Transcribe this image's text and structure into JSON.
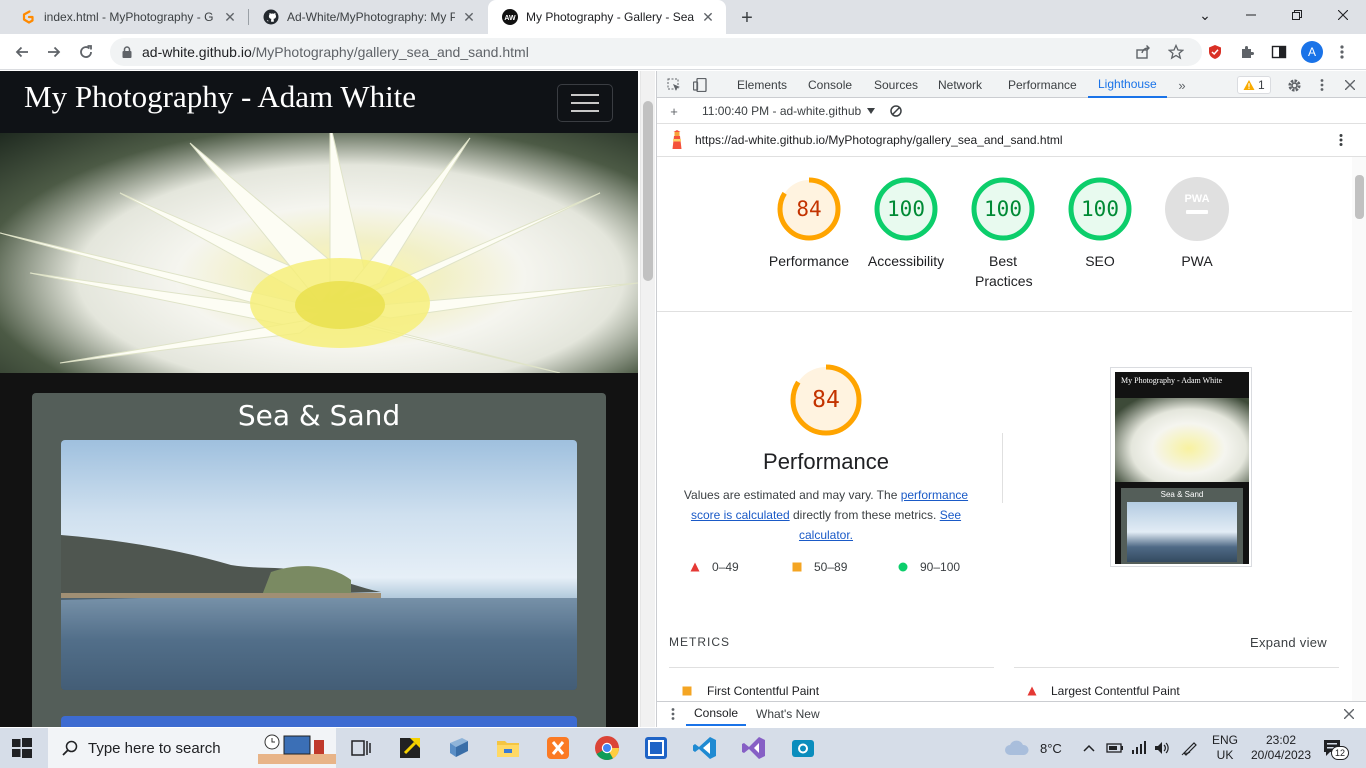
{
  "browser": {
    "tabs": [
      {
        "title": "index.html - MyPhotography - G",
        "favicon": "gitpod-icon"
      },
      {
        "title": "Ad-White/MyPhotography: My P",
        "favicon": "github-icon"
      },
      {
        "title": "My Photography - Gallery - Sea &",
        "favicon": "aw-icon",
        "active": true
      }
    ],
    "favicon_letters": "AW",
    "url_host": "ad-white.github.io",
    "url_path": "/MyPhotography/gallery_sea_and_sand.html",
    "avatar_letter": "A"
  },
  "page": {
    "brand": "My Photography - Adam White",
    "card_title": "Sea & Sand"
  },
  "devtools": {
    "tabs": [
      "Elements",
      "Console",
      "Sources",
      "Network",
      "Performance",
      "Lighthouse"
    ],
    "active_tab": "Lighthouse",
    "warning_count": "1",
    "report_time": "11:00:40 PM - ad-white.github",
    "report_url": "https://ad-white.github.io/MyPhotography/gallery_sea_and_sand.html",
    "scores": [
      {
        "label": "Performance",
        "value": "84",
        "fraction": 0.84,
        "status": "average"
      },
      {
        "label": "Accessibility",
        "value": "100",
        "fraction": 1.0,
        "status": "pass"
      },
      {
        "label": "Best Practices",
        "value": "100",
        "fraction": 1.0,
        "status": "pass"
      },
      {
        "label": "SEO",
        "value": "100",
        "fraction": 1.0,
        "status": "pass"
      },
      {
        "label": "PWA",
        "value": "PWA",
        "fraction": 0,
        "status": "na"
      }
    ],
    "perf": {
      "score": "84",
      "title": "Performance",
      "desc_1": "Values are estimated and may vary. The ",
      "desc_link_1": "performance score is calculated",
      "desc_2": " directly from these metrics. ",
      "desc_link_2": "See calculator."
    },
    "legend": [
      {
        "range": "0–49",
        "shape": "triangle",
        "color": "#e53935"
      },
      {
        "range": "50–89",
        "shape": "square",
        "color": "#f4a523"
      },
      {
        "range": "90–100",
        "shape": "circle",
        "color": "#0cce6b"
      }
    ],
    "thumbnail": {
      "brand": "My Photography - Adam White",
      "card_title": "Sea & Sand"
    },
    "metrics_header": "METRICS",
    "expand_label": "Expand view",
    "metrics": [
      {
        "name": "First Contentful Paint",
        "status": "average"
      },
      {
        "name": "Largest Contentful Paint",
        "status": "fail"
      }
    ],
    "drawer_tabs": [
      "Console",
      "What's New"
    ]
  },
  "taskbar": {
    "search_placeholder": "Type here to search",
    "weather": "8°C",
    "lang_1": "ENG",
    "lang_2": "UK",
    "time": "23:02",
    "date": "20/04/2023",
    "notifications": "12"
  },
  "colors": {
    "pass": "#0cce6b",
    "average": "#ffa400",
    "fail": "#ff4e42",
    "accent": "#1a73e8"
  }
}
